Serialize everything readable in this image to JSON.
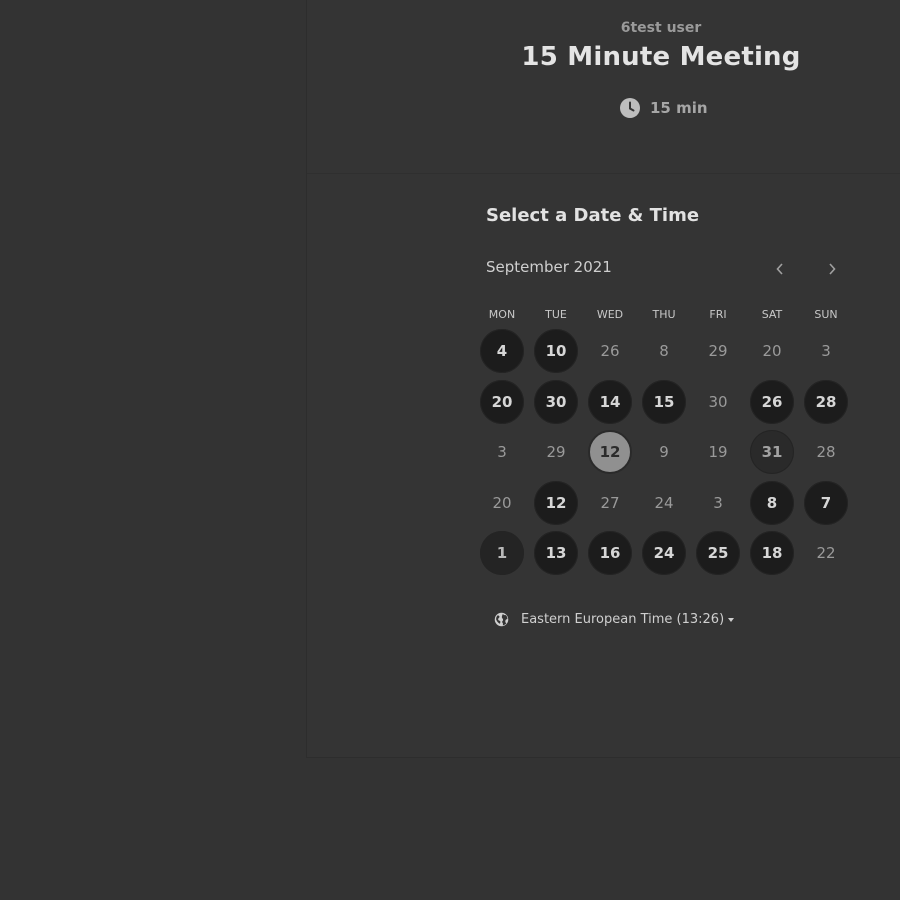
{
  "event": {
    "host_name": "6test user",
    "title": "15 Minute Meeting",
    "duration": "15 min",
    "duration_icon": "clock-icon"
  },
  "picker": {
    "title": "Select a Date & Time",
    "month_label": "September 2021",
    "prev_icon": "chevron-left-icon",
    "next_icon": "chevron-right-icon",
    "weekdays": [
      "MON",
      "TUE",
      "WED",
      "THU",
      "FRI",
      "SAT",
      "SUN"
    ],
    "weeks": [
      [
        {
          "label": "4",
          "state": "available"
        },
        {
          "label": "10",
          "state": "available"
        },
        {
          "label": "26",
          "state": "unavailable"
        },
        {
          "label": "8",
          "state": "unavailable"
        },
        {
          "label": "29",
          "state": "unavailable"
        },
        {
          "label": "20",
          "state": "unavailable"
        },
        {
          "label": "3",
          "state": "unavailable"
        }
      ],
      [
        {
          "label": "20",
          "state": "available"
        },
        {
          "label": "30",
          "state": "available"
        },
        {
          "label": "14",
          "state": "available"
        },
        {
          "label": "15",
          "state": "available"
        },
        {
          "label": "30",
          "state": "unavailable"
        },
        {
          "label": "26",
          "state": "available"
        },
        {
          "label": "28",
          "state": "available"
        }
      ],
      [
        {
          "label": "3",
          "state": "unavailable"
        },
        {
          "label": "29",
          "state": "unavailable"
        },
        {
          "label": "12",
          "state": "selected"
        },
        {
          "label": "9",
          "state": "unavailable"
        },
        {
          "label": "19",
          "state": "unavailable"
        },
        {
          "label": "31",
          "state": "available-dim"
        },
        {
          "label": "28",
          "state": "unavailable"
        }
      ],
      [
        {
          "label": "20",
          "state": "unavailable"
        },
        {
          "label": "12",
          "state": "available"
        },
        {
          "label": "27",
          "state": "unavailable"
        },
        {
          "label": "24",
          "state": "unavailable"
        },
        {
          "label": "3",
          "state": "unavailable"
        },
        {
          "label": "8",
          "state": "available"
        },
        {
          "label": "7",
          "state": "available"
        }
      ],
      [
        {
          "label": "1",
          "state": "available-faded"
        },
        {
          "label": "13",
          "state": "available"
        },
        {
          "label": "16",
          "state": "available"
        },
        {
          "label": "24",
          "state": "available"
        },
        {
          "label": "25",
          "state": "available"
        },
        {
          "label": "18",
          "state": "available"
        },
        {
          "label": "22",
          "state": "unavailable"
        }
      ]
    ]
  },
  "timezone": {
    "label": "Eastern European Time (13:26)",
    "icon": "globe-icon"
  },
  "colors": {
    "background": "#333333",
    "available_day": "#1c1c1c",
    "selected_day": "#909090",
    "text_primary": "#e4e4e4",
    "text_muted": "#9a9a9a"
  }
}
